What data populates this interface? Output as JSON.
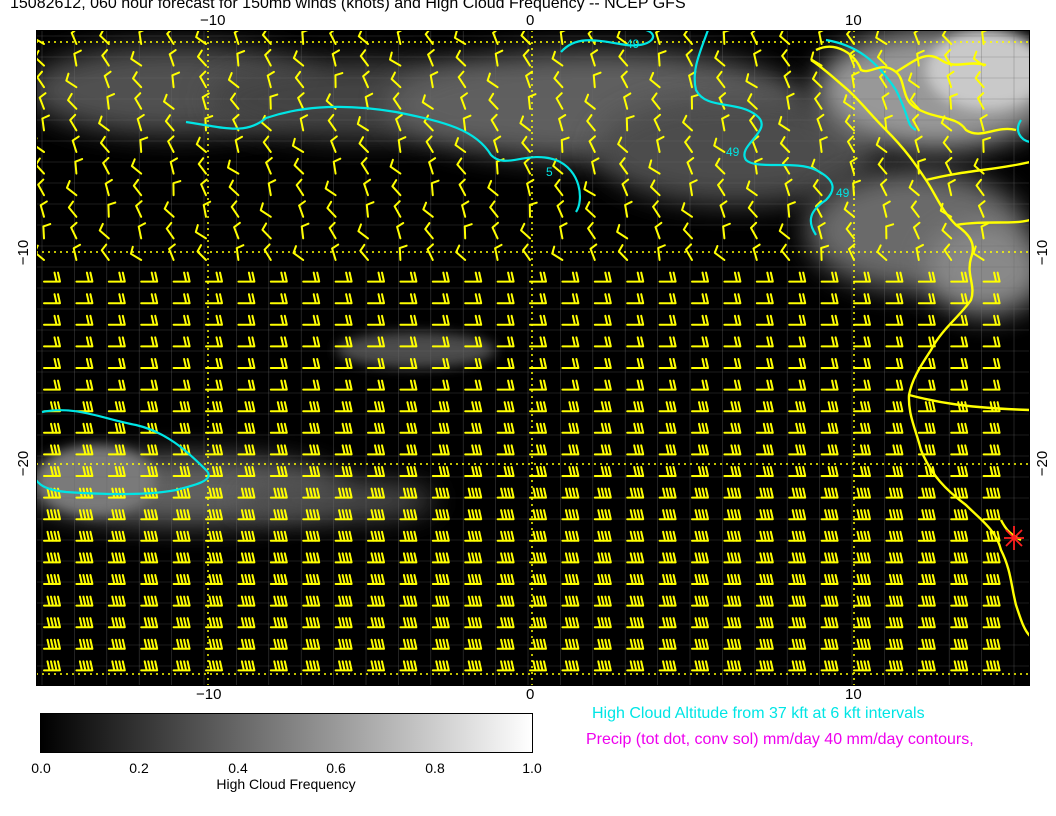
{
  "title": "15082612, 060 hour forecast for 150mb winds (knots) and High Cloud Frequency -- NCEP GFS",
  "axes": {
    "top_lon_labels": [
      "−10",
      "0",
      "10"
    ],
    "bottom_lon_labels": [
      "−10",
      "0",
      "10"
    ],
    "left_lat_labels": [
      "−10",
      "−20"
    ],
    "right_lat_labels": [
      "−10",
      "−20"
    ]
  },
  "map": {
    "background_color": "#000000",
    "barb_color": "#ffff00",
    "coast_color": "#ffff00",
    "contour_color": "#00e5e5",
    "grid_color": "#808080",
    "graticule_color": "#ffff00",
    "marker_color": "#ff2020",
    "contour_labels": [
      "49",
      "49",
      "49",
      "5"
    ],
    "marker": "red-star-marker"
  },
  "colorbar": {
    "ticks": [
      "0.0",
      "0.2",
      "0.4",
      "0.6",
      "0.8",
      "1.0"
    ],
    "title": "High Cloud Frequency",
    "gradient_from": "#000000",
    "gradient_to": "#ffffff"
  },
  "legend": {
    "cloud_altitude": "High Cloud Altitude from 37 kft at 6 kft intervals",
    "cloud_altitude_color": "#00e5e5",
    "precip": "Precip (tot dot, conv sol) mm/day 40 mm/day contours,",
    "precip_color": "#ee00ee"
  }
}
